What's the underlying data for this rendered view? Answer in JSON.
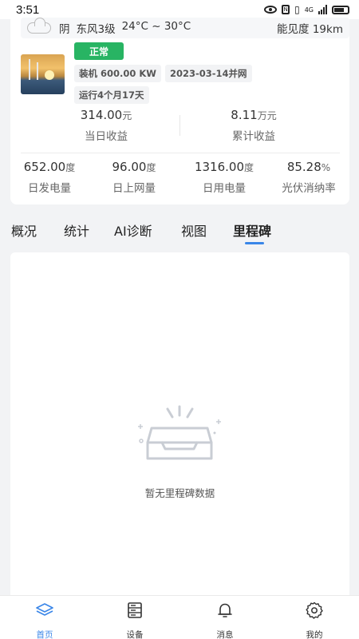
{
  "status_bar": {
    "time": "3:51",
    "network": "4G"
  },
  "weather": {
    "condition": "阴",
    "wind": "东风3级",
    "temp_range": "24°C ~ 30°C",
    "visibility": "能见度 19km",
    "icon": "cloud-icon"
  },
  "station": {
    "status": "正常",
    "status_color": "#28b463",
    "capacity": "装机 600.00 KW",
    "grid_date": "2023-03-14并网",
    "running": "运行4个月17天"
  },
  "earnings": {
    "today_value": "314.00",
    "today_unit": "元",
    "today_label": "当日收益",
    "total_value": "8.11",
    "total_unit": "万元",
    "total_label": "累计收益"
  },
  "energy": [
    {
      "value": "652.00",
      "unit": "度",
      "label": "日发电量"
    },
    {
      "value": "96.00",
      "unit": "度",
      "label": "日上网量"
    },
    {
      "value": "1316.00",
      "unit": "度",
      "label": "日用电量"
    },
    {
      "value": "85.28",
      "unit": "%",
      "label": "光伏消纳率"
    }
  ],
  "tabs": [
    {
      "label": "概况",
      "active": false
    },
    {
      "label": "统计",
      "active": false
    },
    {
      "label": "AI诊断",
      "active": false
    },
    {
      "label": "视图",
      "active": false
    },
    {
      "label": "里程碑",
      "active": true
    }
  ],
  "empty_state": {
    "text": "暂无里程碑数据",
    "icon": "empty-inbox-icon"
  },
  "bottom_nav": [
    {
      "label": "首页",
      "icon": "home-layers-icon",
      "active": true
    },
    {
      "label": "设备",
      "icon": "device-server-icon",
      "active": false
    },
    {
      "label": "消息",
      "icon": "bell-icon",
      "active": false
    },
    {
      "label": "我的",
      "icon": "gear-icon",
      "active": false
    }
  ],
  "colors": {
    "accent": "#3a86e8",
    "background": "#f2f3f5"
  }
}
